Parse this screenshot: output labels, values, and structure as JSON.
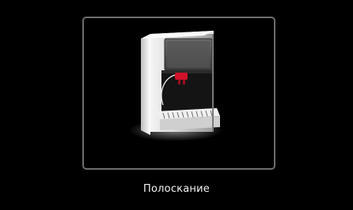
{
  "screen": {
    "caption": "Полоскание",
    "illustration_icon": "coffee-machine-rinse-icon",
    "colors": {
      "background": "#000000",
      "frame_border": "#6e6e6e",
      "caption_text": "#f2f2f2",
      "accent_spout": "#d0122a"
    }
  }
}
